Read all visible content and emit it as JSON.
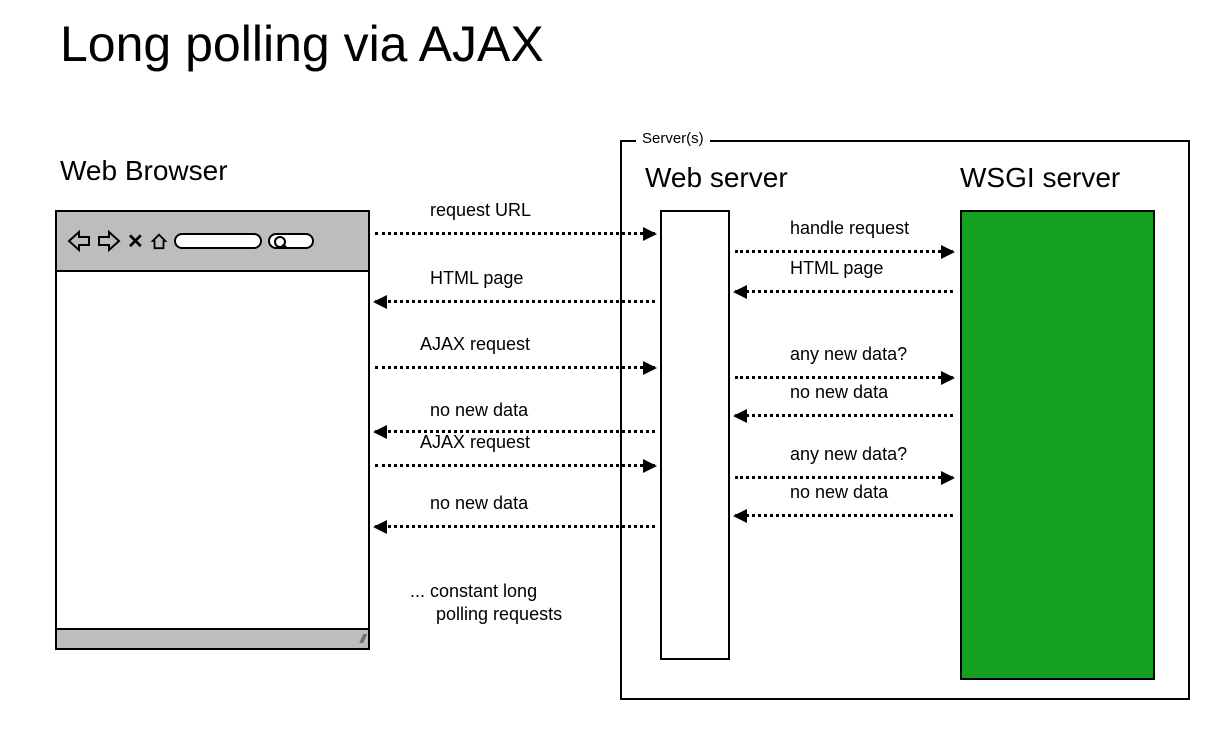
{
  "title": "Long polling via AJAX",
  "browser_label": "Web Browser",
  "server_group_label": "Server(s)",
  "webserver_label": "Web server",
  "wsgi_label": "WSGI server",
  "colors": {
    "wsgi_bar": "#15a022",
    "browser_chrome": "#bdbdbd"
  },
  "messages_left": {
    "m1": "request URL",
    "m2": "HTML page",
    "m3": "AJAX request",
    "m4": "no new data",
    "m5": "AJAX request",
    "m6": "no new data"
  },
  "messages_right": {
    "r1": "handle request",
    "r2": "HTML page",
    "r3": "any new data?",
    "r4": "no new data",
    "r5": "any new data?",
    "r6": "no new data"
  },
  "note_line1": "... constant long",
  "note_line2": "polling requests"
}
